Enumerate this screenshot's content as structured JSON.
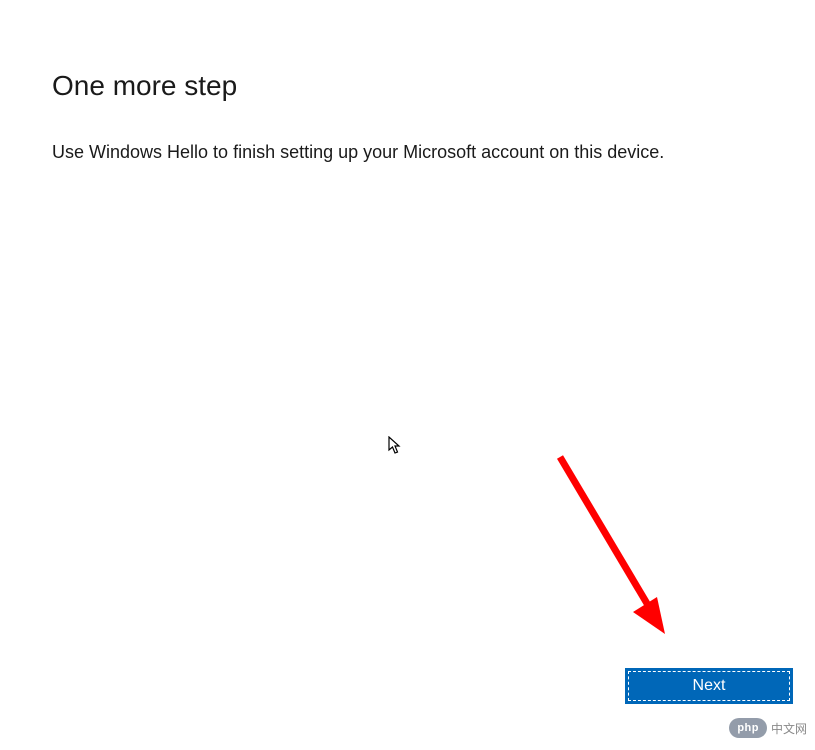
{
  "dialog": {
    "heading": "One more step",
    "description": "Use Windows Hello to finish setting up your Microsoft account on this device.",
    "next_button_label": "Next"
  },
  "watermark": {
    "badge": "php",
    "text": "中文网"
  },
  "colors": {
    "primary_button": "#0067b8",
    "text": "#1a1a1a",
    "annotation_arrow": "#ff0000"
  }
}
